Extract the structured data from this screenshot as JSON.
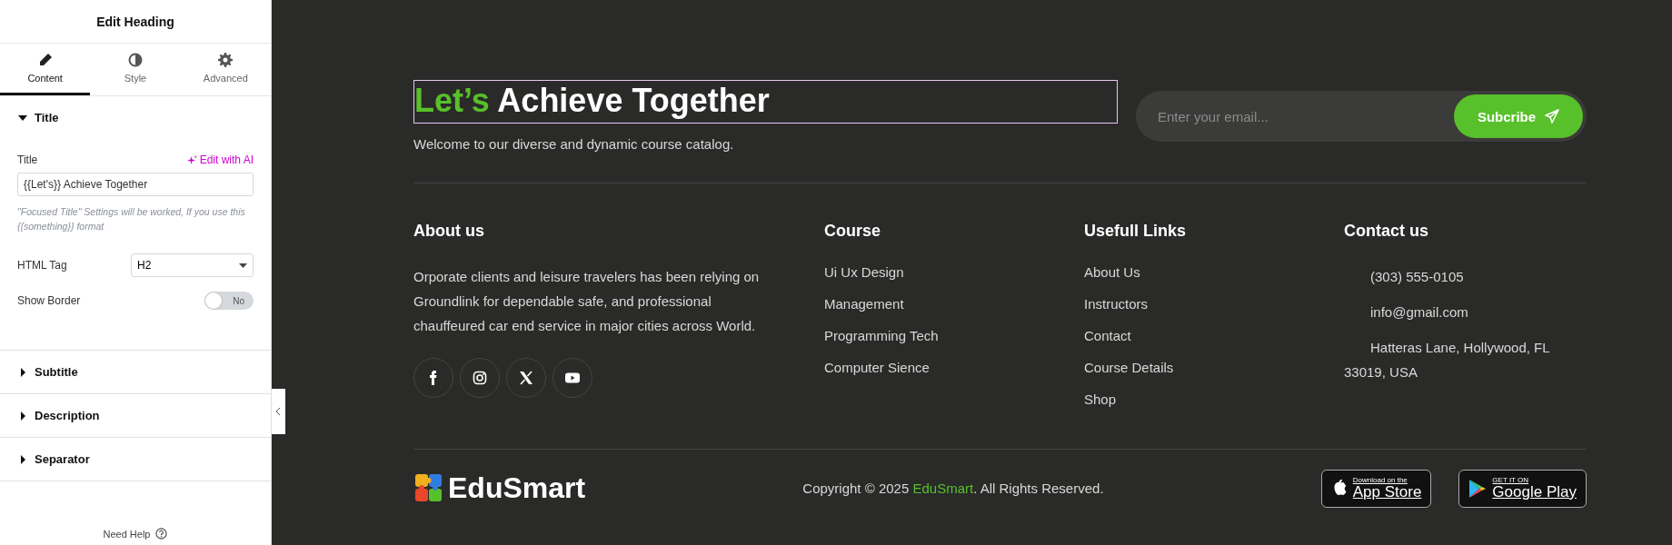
{
  "panel": {
    "title": "Edit Heading",
    "tabs": [
      {
        "label": "Content",
        "kind": "pencil",
        "selected": true
      },
      {
        "label": "Style",
        "kind": "contrast",
        "selected": false
      },
      {
        "label": "Advanced",
        "kind": "gear",
        "selected": false
      }
    ],
    "sections": [
      {
        "label": "Title",
        "expanded": true
      },
      {
        "label": "Subtitle",
        "expanded": false
      },
      {
        "label": "Description",
        "expanded": false
      },
      {
        "label": "Separator",
        "expanded": false
      }
    ],
    "title_field": {
      "label": "Title",
      "ai_link": "Edit with AI",
      "value": "{{Let's}} Achieve Together",
      "hint": "\"Focused Title\" Settings will be worked, If you use this {{something}} format"
    },
    "html_tag": {
      "label": "HTML Tag",
      "value": "H2"
    },
    "show_border": {
      "label": "Show Border",
      "on": false,
      "state_text": "No"
    },
    "help": "Need Help"
  },
  "footer": {
    "heading": {
      "focus": "Let’s",
      "rest": "Achieve Together"
    },
    "tagline": "Welcome to our diverse and dynamic course catalog.",
    "email": {
      "placeholder": "Enter your email...",
      "button": "Subcribe"
    },
    "about": {
      "title": "About us",
      "text": "Orporate clients and leisure travelers has been relying on Groundlink for dependable safe, and professional chauffeured car end service in major cities across World.",
      "social": [
        {
          "kind": "facebook"
        },
        {
          "kind": "instagram"
        },
        {
          "kind": "x"
        },
        {
          "kind": "youtube"
        }
      ]
    },
    "columns": [
      {
        "title": "Course",
        "links": [
          "Ui Ux Design",
          "Management",
          "Programming Tech",
          "Computer Sience"
        ]
      },
      {
        "title": "Usefull Links",
        "links": [
          "About Us",
          "Instructors",
          "Contact",
          "Course Details",
          "Shop"
        ]
      }
    ],
    "contact": {
      "title": "Contact us",
      "items": [
        "(303) 555-0105",
        "info@gmail.com",
        "Hatteras Lane, Hollywood, FL 33019, USA"
      ]
    },
    "brand": "EduSmart",
    "copyright": {
      "before": "Copyright © 2025 ",
      "link": "EduSmart",
      "after": ". All Rights Reserved."
    },
    "stores": [
      {
        "kind": "apple",
        "small": "Download on the",
        "big": "App Store"
      },
      {
        "kind": "google",
        "small": "GET IT ON",
        "big": "Google Play"
      }
    ]
  }
}
